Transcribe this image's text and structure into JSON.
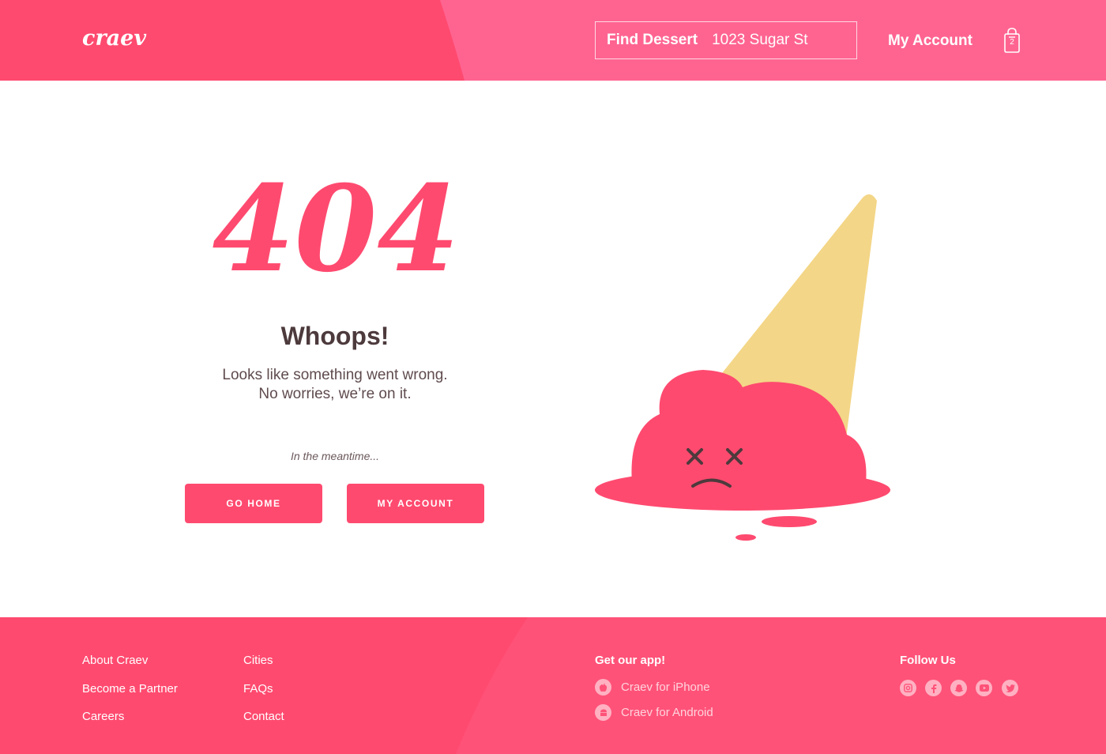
{
  "header": {
    "logo": "craev",
    "search_label": "Find Dessert",
    "search_value": "1023 Sugar St",
    "account_label": "My Account",
    "cart_count": "2"
  },
  "main": {
    "error_code": "404",
    "title": "Whoops!",
    "subtitle_line1": "Looks like something went wrong.",
    "subtitle_line2": "No worries, we’re on it.",
    "meantime": "In the meantime...",
    "go_home_label": "GO HOME",
    "my_account_label": "MY ACCOUNT"
  },
  "footer": {
    "col1": [
      "About Craev",
      "Become a Partner",
      "Careers"
    ],
    "col2": [
      "Cities",
      "FAQs",
      "Contact"
    ],
    "app_heading": "Get our app!",
    "app_iphone": "Craev for iPhone",
    "app_android": "Craev for Android",
    "follow_heading": "Follow Us",
    "social": [
      "instagram-icon",
      "facebook-icon",
      "snapchat-icon",
      "youtube-icon",
      "twitter-icon"
    ]
  },
  "colors": {
    "primary": "#ff4a6f",
    "header_light": "#ff6491",
    "cone": "#f3d687",
    "text_dark": "#4d3a3d"
  }
}
